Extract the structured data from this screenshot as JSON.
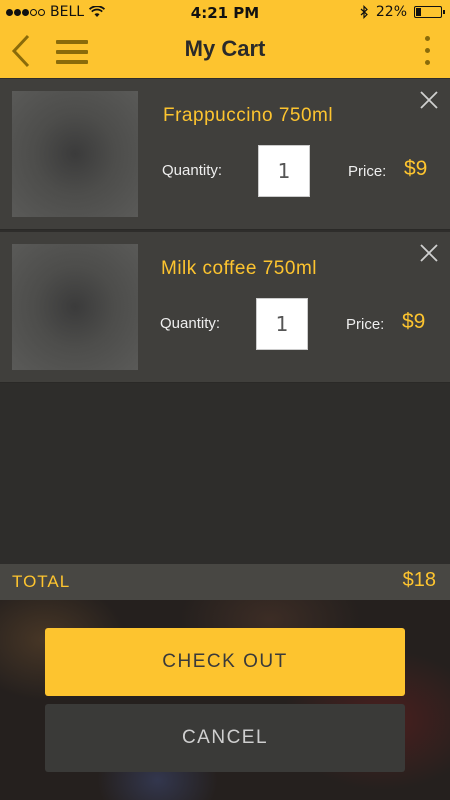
{
  "status_bar": {
    "carrier": "BELL",
    "time": "4:21 PM",
    "battery": "22%",
    "signal_dots": 5,
    "signal_filled": 3
  },
  "nav": {
    "title": "My Cart",
    "back_icon": "chevron-left-icon",
    "menu_icon": "hamburger-menu-icon",
    "more_icon": "more-vertical-icon"
  },
  "items": [
    {
      "name": "Frappuccino 750ml",
      "quantity_label": "Quantity:",
      "quantity": "1",
      "price_label": "Price:",
      "price": "$9"
    },
    {
      "name": "Milk coffee 750ml",
      "quantity_label": "Quantity:",
      "quantity": "1",
      "price_label": "Price:",
      "price": "$9"
    }
  ],
  "total": {
    "label": "TOTAL",
    "amount": "$18"
  },
  "buttons": {
    "checkout": "CHECK OUT",
    "cancel": "CANCEL"
  },
  "colors": {
    "accent": "#fdc42f",
    "background": "#2e2d2b",
    "card": "#403f3c"
  }
}
